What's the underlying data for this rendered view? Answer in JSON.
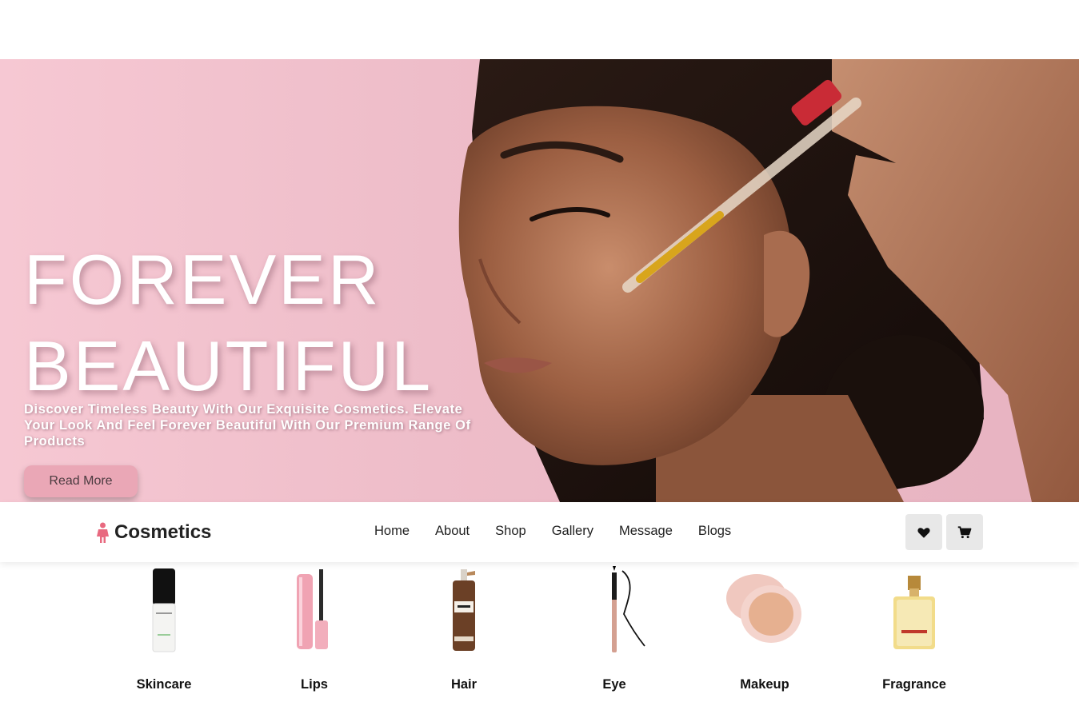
{
  "hero": {
    "title_line1": "FOREVER",
    "title_line2": "BEAUTIFUL",
    "subtitle": "Discover Timeless Beauty With Our Exquisite Cosmetics. Elevate Your Look And Feel Forever Beautiful With Our Premium Range Of Products",
    "button_label": "Read More"
  },
  "brand": {
    "name": "Cosmetics",
    "icon": "woman-icon"
  },
  "nav": {
    "items": [
      {
        "label": "Home"
      },
      {
        "label": "About"
      },
      {
        "label": "Shop"
      },
      {
        "label": "Gallery"
      },
      {
        "label": "Message"
      },
      {
        "label": "Blogs"
      }
    ]
  },
  "actions": {
    "wishlist_icon": "heart-icon",
    "cart_icon": "shopping-cart-icon"
  },
  "categories": [
    {
      "label": "Skincare",
      "icon": "serum-bottle-icon"
    },
    {
      "label": "Lips",
      "icon": "lip-gloss-icon"
    },
    {
      "label": "Hair",
      "icon": "hair-product-bottle-icon"
    },
    {
      "label": "Eye",
      "icon": "eyeliner-pen-icon"
    },
    {
      "label": "Makeup",
      "icon": "cream-jar-icon"
    },
    {
      "label": "Fragrance",
      "icon": "perfume-bottle-icon"
    }
  ],
  "colors": {
    "hero_bg": "#eebdc9",
    "button_bg": "#eaa7b6",
    "brand_accent": "#e8697f",
    "icon_button_bg": "#e8e8e8"
  }
}
